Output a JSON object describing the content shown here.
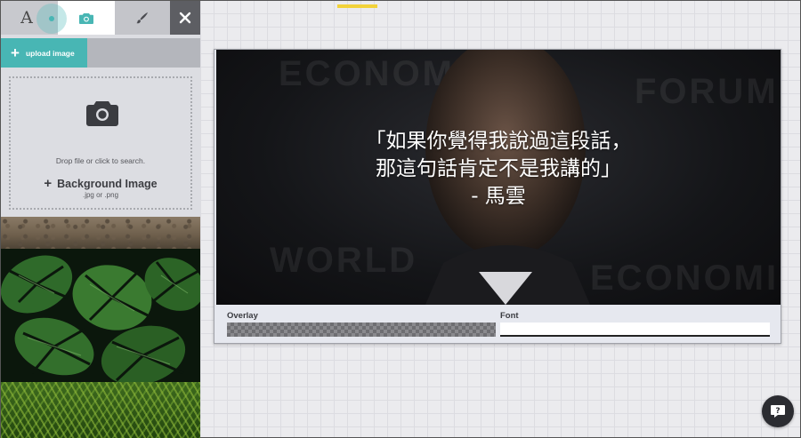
{
  "toolbar": {
    "text_tool_glyph": "A",
    "text_tool_icon": "text-icon",
    "image_tool_icon": "camera-icon",
    "brush_tool_icon": "brush-icon",
    "close_icon": "close-icon"
  },
  "upload": {
    "button_label": "upload image",
    "plus": "+"
  },
  "dropzone": {
    "icon": "camera-icon",
    "hint": "Drop file or click to search.",
    "plus": "+",
    "title": "Background Image",
    "formats": ".jpg or .png"
  },
  "gallery": {
    "items": [
      "dirt-thumbnail",
      "monstera-leaves-thumbnail",
      "fern-thumbnail"
    ]
  },
  "canvas": {
    "quote_line1": "「如果你覺得我說過這段話，",
    "quote_line2": "那這句話肯定不是我講的」",
    "quote_line3": "- 馬雲",
    "overlay_label": "Overlay",
    "font_label": "Font"
  },
  "help": {
    "icon": "help-chat-icon",
    "glyph": "?"
  },
  "colors": {
    "accent": "#48b6b4",
    "indicator": "#f2d23a",
    "close_bg": "#5d5e63",
    "font_color": "#ffffff"
  }
}
